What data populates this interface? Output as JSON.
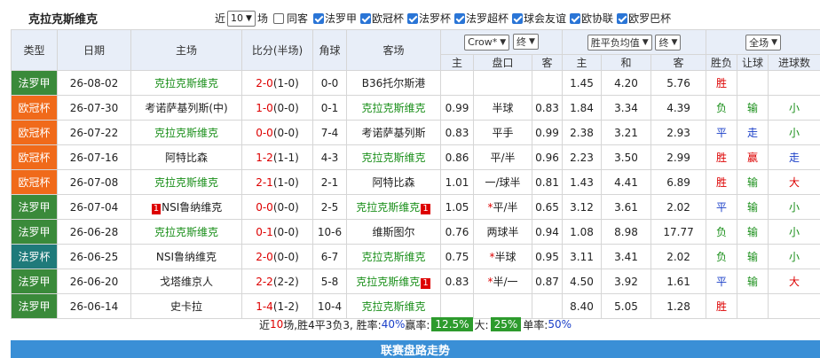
{
  "title": "克拉克斯维克",
  "controls": {
    "recent_label": "近",
    "recent_value": "10",
    "recent_unit": "场",
    "same_home_label": "同客",
    "filters": [
      "法罗甲",
      "欧冠杯",
      "法罗杯",
      "法罗超杯",
      "球会友谊",
      "欧协联",
      "欧罗巴杯"
    ]
  },
  "headers": {
    "type": "类型",
    "date": "日期",
    "home": "主场",
    "score": "比分(半场)",
    "corner": "角球",
    "away": "客场",
    "company_select": "Crow*",
    "company_select2": "终",
    "odds_select": "胜平负均值",
    "odds_select2": "终",
    "field_select": "全场",
    "result": "胜负",
    "handicap_res": "让球",
    "ou_res": "进球数",
    "sub_home": "主",
    "sub_line": "盘口",
    "sub_away": "客",
    "sub_win": "主",
    "sub_draw": "和",
    "sub_lose": "客"
  },
  "colors": {
    "league_faroe": "#2e7d32",
    "league_ucl": "#f06a1a",
    "league_cup": "#1f7a7a",
    "header_bg": "#e8eef8",
    "win": "#dd0000",
    "draw": "#1a3fc8",
    "loss": "#1a8f1a"
  },
  "rows": [
    {
      "league": "法罗甲",
      "lcolor": "#3a8a3a",
      "date": "26-08-02",
      "home": "克拉克斯维克",
      "home_hl": true,
      "score": "2-0",
      "half": "(1-0)",
      "corner": "0-0",
      "away": "B36托尔斯港",
      "away_hl": false,
      "ah": "",
      "line": "",
      "aa": "",
      "w": "1.45",
      "d": "4.20",
      "l": "5.76",
      "res": "胜",
      "hres": "",
      "ou": ""
    },
    {
      "league": "欧冠杯",
      "lcolor": "#f06a1a",
      "date": "26-07-30",
      "home": "考诺萨基列斯(中)",
      "home_hl": false,
      "score": "1-0",
      "half": "(0-0)",
      "corner": "0-1",
      "away": "克拉克斯维克",
      "away_hl": true,
      "ah": "0.99",
      "line": "半球",
      "aa": "0.83",
      "w": "1.84",
      "d": "3.34",
      "l": "4.39",
      "res": "负",
      "hres": "输",
      "ou": "小"
    },
    {
      "league": "欧冠杯",
      "lcolor": "#f06a1a",
      "date": "26-07-22",
      "home": "克拉克斯维克",
      "home_hl": true,
      "score": "0-0",
      "half": "(0-0)",
      "corner": "7-4",
      "away": "考诺萨基列斯",
      "away_hl": false,
      "ah": "0.83",
      "line": "平手",
      "aa": "0.99",
      "w": "2.38",
      "d": "3.21",
      "l": "2.93",
      "res": "平",
      "hres": "走",
      "ou": "小"
    },
    {
      "league": "欧冠杯",
      "lcolor": "#f06a1a",
      "date": "26-07-16",
      "home": "阿特比森",
      "home_hl": false,
      "score": "1-2",
      "half": "(1-1)",
      "corner": "4-3",
      "away": "克拉克斯维克",
      "away_hl": true,
      "ah": "0.86",
      "line": "平/半",
      "aa": "0.96",
      "w": "2.23",
      "d": "3.50",
      "l": "2.99",
      "res": "胜",
      "hres": "赢",
      "ou": "走"
    },
    {
      "league": "欧冠杯",
      "lcolor": "#f06a1a",
      "date": "26-07-08",
      "home": "克拉克斯维克",
      "home_hl": true,
      "score": "2-1",
      "half": "(1-0)",
      "corner": "2-1",
      "away": "阿特比森",
      "away_hl": false,
      "ah": "1.01",
      "line": "一/球半",
      "aa": "0.81",
      "w": "1.43",
      "d": "4.41",
      "l": "6.89",
      "res": "胜",
      "hres": "输",
      "ou": "大"
    },
    {
      "league": "法罗甲",
      "lcolor": "#3a8a3a",
      "date": "26-07-04",
      "home": "NSI鲁纳维克",
      "home_pre": "1",
      "home_hl": false,
      "score": "0-0",
      "half": "(0-0)",
      "corner": "2-5",
      "away": "克拉克斯维克",
      "away_post": "1",
      "away_hl": true,
      "ah": "1.05",
      "line": "平/半",
      "line_star": true,
      "aa": "0.65",
      "w": "3.12",
      "d": "3.61",
      "l": "2.02",
      "res": "平",
      "hres": "输",
      "ou": "小"
    },
    {
      "league": "法罗甲",
      "lcolor": "#3a8a3a",
      "date": "26-06-28",
      "home": "克拉克斯维克",
      "home_hl": true,
      "score": "0-1",
      "half": "(0-0)",
      "corner": "10-6",
      "away": "维斯图尔",
      "away_hl": false,
      "ah": "0.76",
      "line": "两球半",
      "aa": "0.94",
      "w": "1.08",
      "d": "8.98",
      "l": "17.77",
      "res": "负",
      "hres": "输",
      "ou": "小"
    },
    {
      "league": "法罗杯",
      "lcolor": "#1f7a7a",
      "date": "26-06-25",
      "home": "NSI鲁纳维克",
      "home_hl": false,
      "score": "2-0",
      "half": "(0-0)",
      "corner": "6-7",
      "away": "克拉克斯维克",
      "away_hl": true,
      "ah": "0.75",
      "line": "半球",
      "line_star": true,
      "aa": "0.95",
      "w": "3.11",
      "d": "3.41",
      "l": "2.02",
      "res": "负",
      "hres": "输",
      "ou": "小"
    },
    {
      "league": "法罗甲",
      "lcolor": "#3a8a3a",
      "date": "26-06-20",
      "home": "戈塔维京人",
      "home_hl": false,
      "score": "2-2",
      "half": "(2-2)",
      "corner": "5-8",
      "away": "克拉克斯维克",
      "away_post": "1",
      "away_hl": true,
      "ah": "0.83",
      "line": "半/一",
      "line_star": true,
      "aa": "0.87",
      "w": "4.50",
      "d": "3.92",
      "l": "1.61",
      "res": "平",
      "hres": "输",
      "ou": "大"
    },
    {
      "league": "法罗甲",
      "lcolor": "#3a8a3a",
      "date": "26-06-14",
      "home": "史卡拉",
      "home_hl": false,
      "score": "1-4",
      "half": "(1-2)",
      "corner": "10-4",
      "away": "克拉克斯维克",
      "away_hl": true,
      "ah": "",
      "line": "",
      "aa": "",
      "w": "8.40",
      "d": "5.05",
      "l": "1.28",
      "res": "胜",
      "hres": "",
      "ou": ""
    }
  ],
  "summary": {
    "p1": "近",
    "n": "10",
    "p2": "场,胜4平3负3, 胜率:",
    "winrate": "40%",
    "p3": "赢率:",
    "ahrate": "12.5%",
    "p4": "大:",
    "bigrate": "25%",
    "p5": "单率:",
    "oddrate": "50%"
  },
  "footer": "联赛盘路走势"
}
